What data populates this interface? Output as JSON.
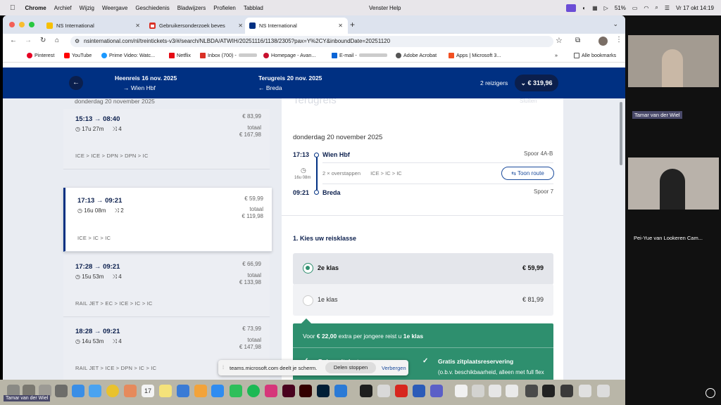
{
  "menubar": {
    "app": "Chrome",
    "items": [
      "Archief",
      "Wijzig",
      "Weergave",
      "Geschiedenis",
      "Bladwijzers",
      "Profielen",
      "Tabblad"
    ],
    "right_items": [
      "Venster",
      "Help"
    ],
    "battery": "51%",
    "clock": "Vr 17 okt  14:19"
  },
  "tabs": [
    {
      "label": "NS International"
    },
    {
      "label": "Gebruikersonderzoek beves"
    },
    {
      "label": "NS International"
    }
  ],
  "address": {
    "url": "nsinternational.com/nl/treintickets-v3/#/search/NLBDA/ATWIH/20251116/1138/2305?pax=Y%2CY&inboundDate=20251120"
  },
  "bookmarks": [
    "Pinterest",
    "YouTube",
    "Prime Video: Watc...",
    "Netflix",
    "Inbox (700) -",
    "Homepage - Avan...",
    "E-mail -",
    "Adobe Acrobat",
    "Apps | Microsoft 3..."
  ],
  "bookmarks_more": "»",
  "bookmarks_all": "Alle bookmarks",
  "header": {
    "outbound_title": "Heenreis 16 nov. 2025",
    "outbound_dest": "Wien Hbf",
    "inbound_title": "Terugreis 20 nov. 2025",
    "inbound_dest": "Breda",
    "travellers": "2 reizigers",
    "total_price": "€ 319,96"
  },
  "left": {
    "date_heading": "donderdag 20 november 2025",
    "cards": [
      {
        "times": "15:13 → 08:40",
        "duration": "17u 27m",
        "transfers": "4",
        "price": "€ 83,99",
        "total_label": "totaal",
        "total": "€ 167,98",
        "route": "ICE  >  ICE  >  DPN  >  DPN  >  IC"
      },
      {
        "times": "17:13 → 09:21",
        "duration": "16u 08m",
        "transfers": "2",
        "price": "€ 59,99",
        "total_label": "totaal",
        "total": "€ 119,98",
        "route": "ICE  >  IC  >  IC"
      },
      {
        "times": "17:28 → 09:21",
        "duration": "15u 53m",
        "transfers": "4",
        "price": "€ 66,99",
        "total_label": "totaal",
        "total": "€ 133,98",
        "route": "RAIL JET  >  EC  >  ICE  >  IC  >  IC"
      },
      {
        "times": "18:28 → 09:21",
        "duration": "14u 53m",
        "transfers": "4",
        "price": "€ 73,99",
        "total_label": "totaal",
        "total": "€ 147,98",
        "route": "RAIL JET  >  ICE  >  DPN  >  IC  >  IC"
      }
    ]
  },
  "right": {
    "faded_title": "Terugreis",
    "faded_link": "Sluiten",
    "date": "donderdag 20 november 2025",
    "dep_time": "17:13",
    "dep_station": "Wien Hbf",
    "dep_platform": "Spoor 4A-B",
    "duration": "16u 08m",
    "transfers_text": "2 × overstappen",
    "legs": "ICE  >  IC  >  IC",
    "route_button": "Toon route",
    "arr_time": "09:21",
    "arr_station": "Breda",
    "arr_platform": "Spoor 7",
    "class_heading": "1. Kies uw reisklasse",
    "class2_label": "2e klas",
    "class2_price": "€ 59,99",
    "class1_label": "1e klas",
    "class1_price": "€ 81,99",
    "promo_pre": "Voor ",
    "promo_amount": "€ 22,00",
    "promo_mid": " extra per jongere reist u ",
    "promo_class": "1e klas",
    "feature1": "Ruime zitplaats",
    "feature2": "Gratis zitplaatsreservering",
    "feature2_note": "(o.b.v. beschikbaarheid, alleen met full flex tarief, ICE)"
  },
  "share_bar": {
    "text": "teams.microsoft.com deelt je scherm.",
    "stop": "Delen stoppen",
    "hide": "Verbergen"
  },
  "participants": {
    "top_name": "Tamar van der Wiel",
    "bottom_name": "Pei-Yue van Lookeren Cam...",
    "self_name": "Tamar van der Wiel"
  },
  "colors": {
    "ns_blue": "#003082",
    "green": "#2e8f6e",
    "link_blue": "#1a4b9c"
  }
}
